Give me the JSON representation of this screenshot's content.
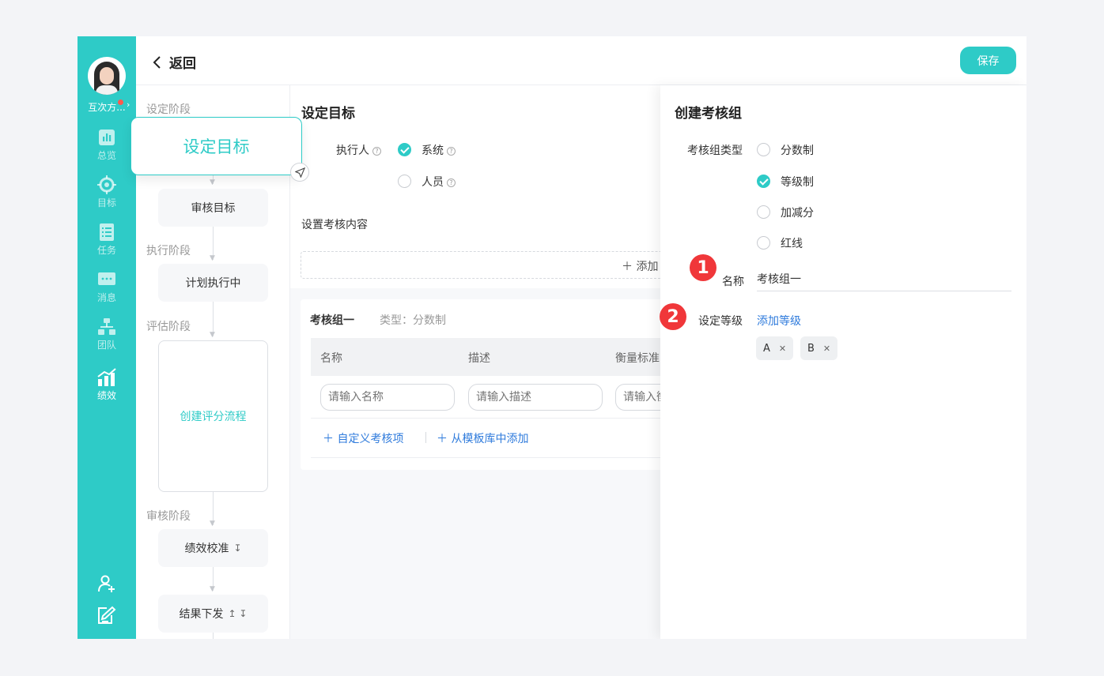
{
  "header": {
    "back_label": "返回",
    "save_label": "保存"
  },
  "user": {
    "name": "互次方..."
  },
  "nav": [
    {
      "label": "总览",
      "icon": "chart-icon"
    },
    {
      "label": "目标",
      "icon": "target-icon"
    },
    {
      "label": "任务",
      "icon": "task-list-icon"
    },
    {
      "label": "消息",
      "icon": "message-icon"
    },
    {
      "label": "团队",
      "icon": "team-icon"
    },
    {
      "label": "绩效",
      "icon": "performance-icon",
      "active": true
    }
  ],
  "rail_bottom": [
    "add-user-icon",
    "edit-note-icon"
  ],
  "flow": {
    "stage_set": "设定阶段",
    "dragging_card": "设定目标",
    "review_goal": "审核目标",
    "stage_exec": "执行阶段",
    "executing": "计划执行中",
    "stage_eval": "评估阶段",
    "create_scoring": "创建评分流程",
    "stage_review": "审核阶段",
    "calibrate": "绩效校准",
    "calibrate_sort": "↧",
    "publish": "结果下发",
    "publish_sort": "↥ ↧"
  },
  "main": {
    "title": "设定目标",
    "executor_label": "执行人",
    "opt_system": "系统",
    "opt_person": "人员",
    "content_label": "设置考核内容",
    "add_label": "＋ 添加",
    "group": {
      "name": "考核组一",
      "type": "类型：分数制",
      "columns": [
        "名称",
        "描述",
        "衡量标准"
      ],
      "placeholders": [
        "请输入名称",
        "请输入描述",
        "请输入衡量标准"
      ],
      "custom_item": "自定义考核项",
      "from_template": "从模板库中添加"
    }
  },
  "panel": {
    "title": "创建考核组",
    "type_label": "考核组类型",
    "types": [
      {
        "label": "分数制",
        "checked": false
      },
      {
        "label": "等级制",
        "checked": true
      },
      {
        "label": "加减分",
        "checked": false
      },
      {
        "label": "红线",
        "checked": false
      }
    ],
    "name_label": "名称",
    "name_value": "考核组一",
    "level_label": "设定等级",
    "add_level": "添加等级",
    "levels": [
      "A",
      "B"
    ],
    "badges": [
      "1",
      "2"
    ]
  },
  "colors": {
    "accent": "#2ecbc7",
    "link": "#2f7bdc",
    "badge": "#f0373a"
  }
}
